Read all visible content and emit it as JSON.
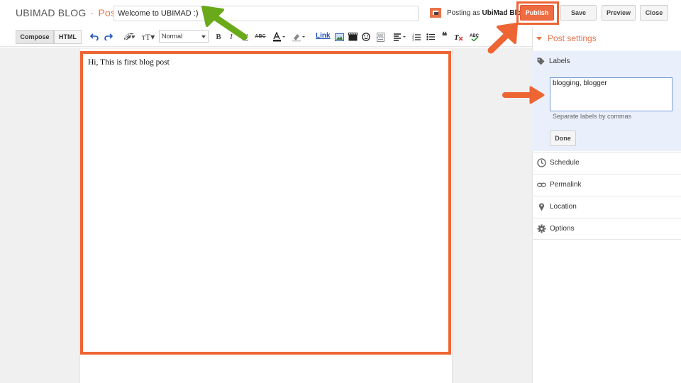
{
  "header": {
    "blog_name": "UBIMAD BLOG",
    "separator": "·",
    "section": "Post",
    "title_value": "Welcome to UBIMAD :)",
    "posting_as_prefix": "Posting as",
    "posting_as_name": "UbiMad Blog",
    "buttons": {
      "publish": "Publish",
      "save": "Save",
      "preview": "Preview",
      "close": "Close"
    }
  },
  "toolbar": {
    "compose": "Compose",
    "html": "HTML",
    "format_value": "Normal",
    "link": "Link"
  },
  "editor": {
    "body_text": "Hi, This is first blog post"
  },
  "sidebar": {
    "post_settings": "Post settings",
    "labels": {
      "title": "Labels",
      "value": "blogging, blogger",
      "hint": "Separate labels by commas",
      "done": "Done"
    },
    "items": [
      {
        "label": "Schedule",
        "icon": "clock-icon"
      },
      {
        "label": "Permalink",
        "icon": "link-icon"
      },
      {
        "label": "Location",
        "icon": "pin-icon"
      },
      {
        "label": "Options",
        "icon": "gear-icon"
      }
    ]
  },
  "colors": {
    "accent_orange": "#ef6c41",
    "highlight_orange": "#ee6534",
    "arrow_green": "#6aaa1a",
    "labels_panel_bg": "#e9f0fb"
  }
}
